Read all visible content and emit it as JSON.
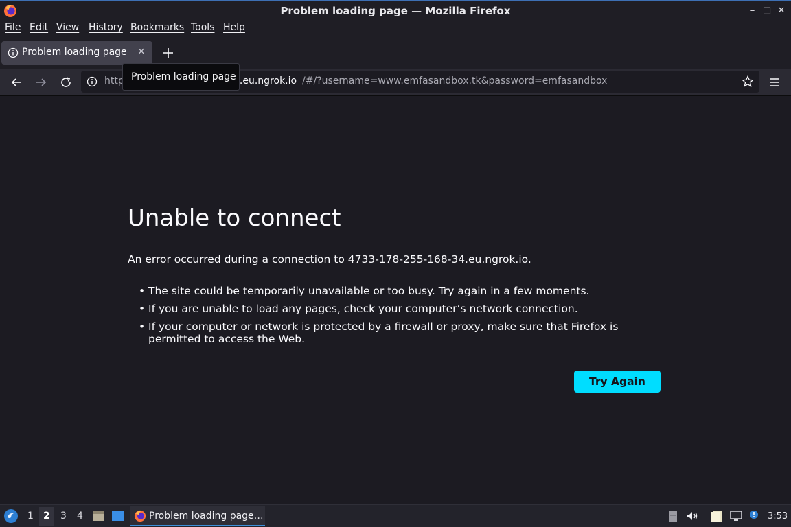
{
  "window": {
    "title": "Problem loading page — Mozilla Firefox",
    "minimize_glyph": "–",
    "maximize_glyph": "□",
    "close_glyph": "✕"
  },
  "menu": {
    "items": [
      "File",
      "Edit",
      "View",
      "History",
      "Bookmarks",
      "Tools",
      "Help"
    ]
  },
  "tab": {
    "label": "Problem loading page",
    "close_glyph": "×"
  },
  "url": {
    "prefix": "http",
    "domain": "4.eu.ngrok.io",
    "rest": "/#/?username=www.emfasandbox.tk&password=emfasandbox"
  },
  "tooltip": {
    "text": "Problem loading page"
  },
  "error": {
    "title": "Unable to connect",
    "description": "An error occurred during a connection to 4733-178-255-168-34.eu.ngrok.io.",
    "bullets": [
      "The site could be temporarily unavailable or too busy. Try again in a few moments.",
      "If you are unable to load any pages, check your computer’s network connection.",
      "If your computer or network is protected by a firewall or proxy, make sure that Firefox is permitted to access the Web."
    ],
    "button_label": "Try Again"
  },
  "taskbar": {
    "workspaces": [
      "1",
      "2",
      "3",
      "4"
    ],
    "active_workspace": "2",
    "task_label": "Problem loading page…",
    "clock": "3:53"
  },
  "colors": {
    "accent": "#00ddff",
    "background": "#1c1b22",
    "toolbar": "#2b2a33"
  }
}
